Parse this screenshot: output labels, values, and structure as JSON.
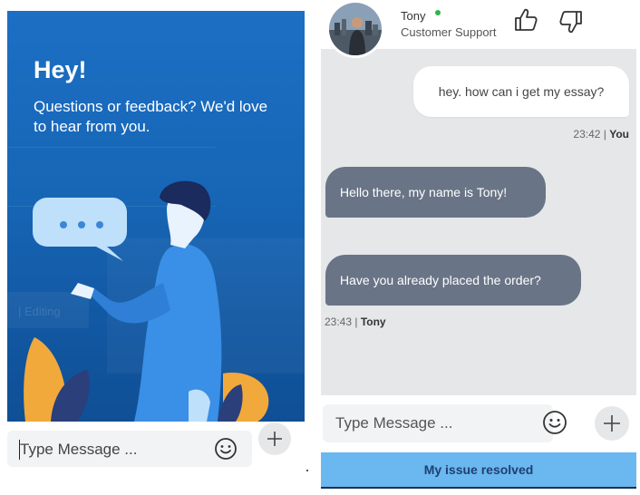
{
  "left": {
    "hero": {
      "title": "Hey!",
      "subtitle": "Questions or feedback? We'd love to hear from you."
    },
    "input": {
      "placeholder": "Type Message ..."
    },
    "emoji_icon": "smiley-icon",
    "plus_icon": "plus-icon"
  },
  "right": {
    "agent": {
      "name": "Tony",
      "role": "Customer Support",
      "status": "online"
    },
    "messages": [
      {
        "from": "You",
        "text": "hey. how can i get my essay?",
        "time": "23:42",
        "sender_label": "You"
      },
      {
        "from": "Tony",
        "text": "Hello there, my name is Tony!"
      },
      {
        "from": "Tony",
        "text": "Have you already placed the order?",
        "time": "23:43",
        "sender_label": "Tony"
      }
    ],
    "input": {
      "placeholder": "Type Message ..."
    },
    "resolved_label": "My issue resolved",
    "time_sep": " | "
  },
  "colors": {
    "hero_blue": "#1766b6",
    "agent_bubble": "#697486",
    "resolved_bg": "#6bb7f0",
    "online": "#2fb24c"
  }
}
